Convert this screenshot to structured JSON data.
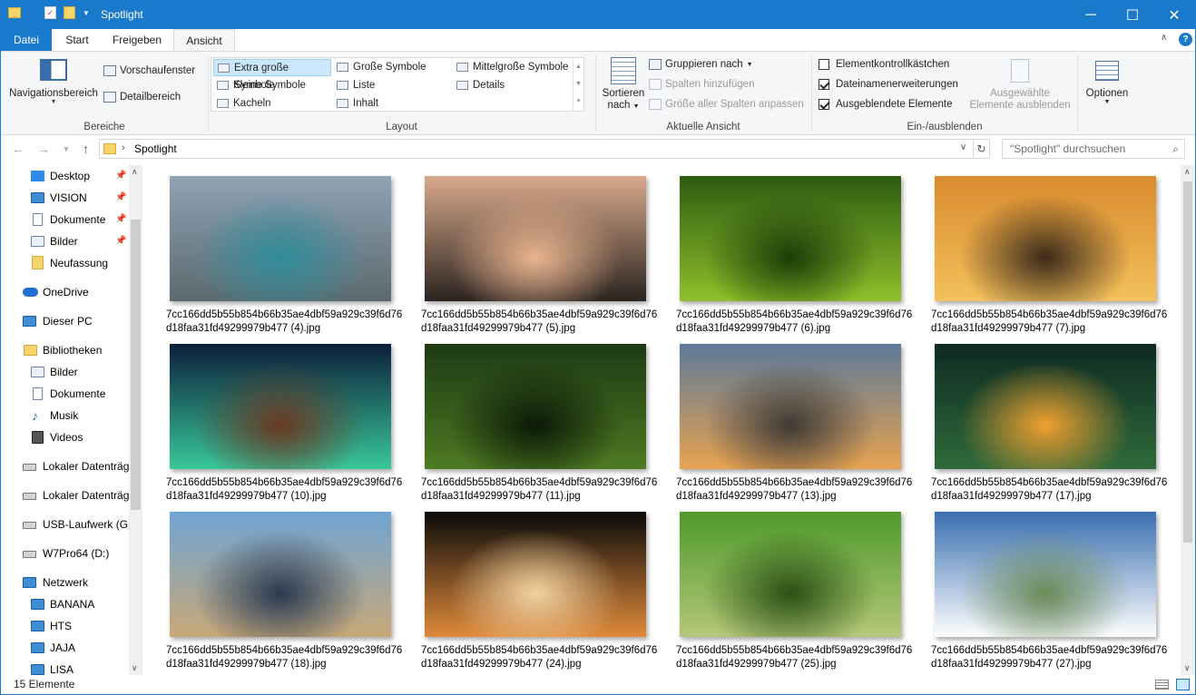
{
  "window": {
    "title": "Spotlight",
    "minimize": "─",
    "maximize": "☐",
    "close": "✕"
  },
  "tabs": {
    "file": "Datei",
    "start": "Start",
    "share": "Freigeben",
    "view": "Ansicht"
  },
  "ribbon": {
    "bereiche": {
      "label": "Bereiche",
      "nav_pane": "Navigationsbereich",
      "preview_pane": "Vorschaufenster",
      "details_pane": "Detailbereich"
    },
    "layout": {
      "label": "Layout",
      "xl_icons": "Extra große Symbole",
      "large_icons": "Große Symbole",
      "medium_icons": "Mittelgroße Symbole",
      "small_icons": "Kleine Symbole",
      "list": "Liste",
      "details": "Details",
      "tiles": "Kacheln",
      "content": "Inhalt"
    },
    "current_view": {
      "label": "Aktuelle Ansicht",
      "sort_line1": "Sortieren",
      "sort_line2": "nach",
      "group_by": "Gruppieren nach",
      "add_columns": "Spalten hinzufügen",
      "size_columns": "Größe aller Spalten anpassen"
    },
    "show_hide": {
      "label": "Ein-/ausblenden",
      "item_checkboxes": "Elementkontrollkästchen",
      "file_ext": "Dateinamenerweiterungen",
      "hidden_items": "Ausgeblendete Elemente",
      "hide_sel_line1": "Ausgewählte",
      "hide_sel_line2": "Elemente ausblenden"
    },
    "options": {
      "label": "Optionen"
    }
  },
  "address": {
    "crumb": "Spotlight",
    "search_placeholder": "\"Spotlight\" durchsuchen"
  },
  "sidebar": {
    "desktop": "Desktop",
    "vision": "VISION",
    "documents_q": "Dokumente",
    "pictures_q": "Bilder",
    "neufassung": "Neufassung",
    "onedrive": "OneDrive",
    "thispc": "Dieser PC",
    "libraries": "Bibliotheken",
    "lib_pictures": "Bilder",
    "lib_documents": "Dokumente",
    "lib_music": "Musik",
    "lib_videos": "Videos",
    "local1": "Lokaler Datenträg",
    "local2": "Lokaler Datenträg",
    "usb": "USB-Laufwerk (G:)",
    "w7": "W7Pro64 (D:)",
    "network": "Netzwerk",
    "banana": "BANANA",
    "hts": "HTS",
    "jaja": "JAJA",
    "lisa": "LISA"
  },
  "files": [
    {
      "line1": "7cc166dd5b55b854b66b35ae4dbf59a929c39f6d76",
      "line2": "d18faa31fd49299979b477 (4).jpg",
      "colors": [
        "#8fa3b5",
        "#5b6a6e",
        "#2f8c9b"
      ]
    },
    {
      "line1": "7cc166dd5b55b854b66b35ae4dbf59a929c39f6d76",
      "line2": "d18faa31fd49299979b477 (5).jpg",
      "colors": [
        "#d8a98b",
        "#2b2420",
        "#e9b38f"
      ]
    },
    {
      "line1": "7cc166dd5b55b854b66b35ae4dbf59a929c39f6d76",
      "line2": "d18faa31fd49299979b477 (6).jpg",
      "colors": [
        "#2e5c12",
        "#8fbf2a",
        "#1c3d08"
      ]
    },
    {
      "line1": "7cc166dd5b55b854b66b35ae4dbf59a929c39f6d76",
      "line2": "d18faa31fd49299979b477 (7).jpg",
      "colors": [
        "#d98a2e",
        "#f4c15c",
        "#3a2a1a"
      ]
    },
    {
      "line1": "7cc166dd5b55b854b66b35ae4dbf59a929c39f6d76",
      "line2": "d18faa31fd49299979b477 (10).jpg",
      "colors": [
        "#0c1f3a",
        "#38c79a",
        "#6b3a22"
      ]
    },
    {
      "line1": "7cc166dd5b55b854b66b35ae4dbf59a929c39f6d76",
      "line2": "d18faa31fd49299979b477 (11).jpg",
      "colors": [
        "#1d3a14",
        "#4e7a22",
        "#0c1a08"
      ]
    },
    {
      "line1": "7cc166dd5b55b854b66b35ae4dbf59a929c39f6d76",
      "line2": "d18faa31fd49299979b477 (13).jpg",
      "colors": [
        "#5d7a9a",
        "#e7a24f",
        "#3f3a35"
      ]
    },
    {
      "line1": "7cc166dd5b55b854b66b35ae4dbf59a929c39f6d76",
      "line2": "d18faa31fd49299979b477 (17).jpg",
      "colors": [
        "#0e2a22",
        "#2f6a3a",
        "#f0a030"
      ]
    },
    {
      "line1": "7cc166dd5b55b854b66b35ae4dbf59a929c39f6d76",
      "line2": "d18faa31fd49299979b477 (18).jpg",
      "colors": [
        "#6fa4d4",
        "#c8a877",
        "#2a3a50"
      ]
    },
    {
      "line1": "7cc166dd5b55b854b66b35ae4dbf59a929c39f6d76",
      "line2": "d18faa31fd49299979b477 (24).jpg",
      "colors": [
        "#0a0a0a",
        "#e08a3a",
        "#f2d2a0"
      ]
    },
    {
      "line1": "7cc166dd5b55b854b66b35ae4dbf59a929c39f6d76",
      "line2": "d18faa31fd49299979b477 (25).jpg",
      "colors": [
        "#4e9a2a",
        "#b5c77a",
        "#2a5014"
      ]
    },
    {
      "line1": "7cc166dd5b55b854b66b35ae4dbf59a929c39f6d76",
      "line2": "d18faa31fd49299979b477 (27).jpg",
      "colors": [
        "#3a6fb0",
        "#ffffff",
        "#6a8a5a"
      ]
    }
  ],
  "status": {
    "count": "15 Elemente"
  }
}
